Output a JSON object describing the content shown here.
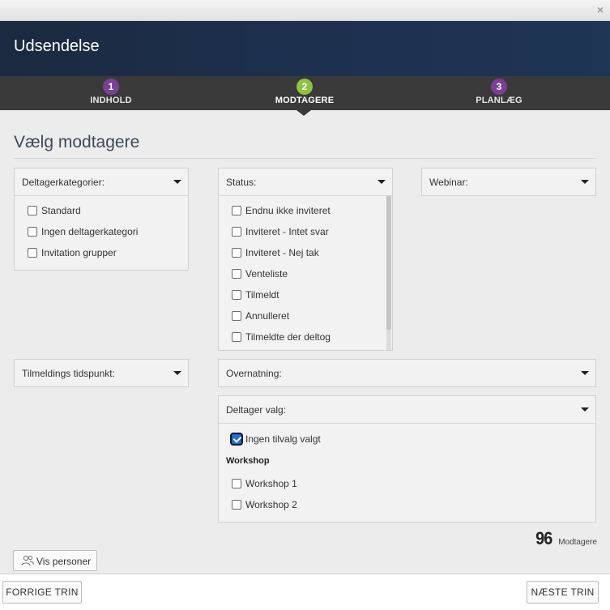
{
  "window": {
    "close_glyph": "×"
  },
  "header": {
    "title": "Udsendelse"
  },
  "steps": [
    {
      "num": "1",
      "label": "INDHOLD",
      "color": "#7b3f96"
    },
    {
      "num": "2",
      "label": "MODTAGERE",
      "color": "#8cc43f"
    },
    {
      "num": "3",
      "label": "PLANLÆG",
      "color": "#7b3f96"
    }
  ],
  "page_title": "Vælg modtagere",
  "filters": {
    "categories": {
      "label": "Deltagerkategorier:",
      "options": [
        "Standard",
        "Ingen deltagerkategori",
        "Invitation grupper"
      ]
    },
    "status": {
      "label": "Status:",
      "options": [
        "Endnu ikke inviteret",
        "Inviteret - Intet svar",
        "Inviteret - Nej tak",
        "Venteliste",
        "Tilmeldt",
        "Annulleret",
        "Tilmeldte der deltog"
      ]
    },
    "webinar": {
      "label": "Webinar:"
    },
    "signup_time": {
      "label": "Tilmeldings tidspunkt:"
    },
    "accommodation": {
      "label": "Overnatning:"
    },
    "participant_choice": {
      "label": "Deltager valg:",
      "none_option": "Ingen tilvalg valgt",
      "none_checked": true,
      "group_title": "Workshop",
      "options": [
        "Workshop 1",
        "Workshop 2"
      ]
    }
  },
  "recipients": {
    "count": "96",
    "label": "Modtagere"
  },
  "buttons": {
    "show_people": "Vis personer",
    "previous": "FORRIGE TRIN",
    "next": "NÆSTE TRIN"
  },
  "icons": {
    "close": "close-icon",
    "caret": "chevron-down-icon",
    "people": "people-icon"
  }
}
